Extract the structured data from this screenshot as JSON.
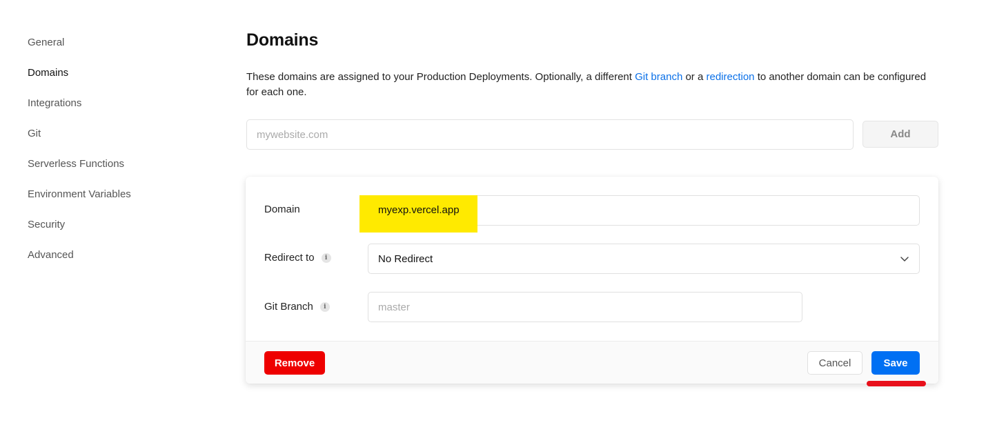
{
  "sidebar": {
    "items": [
      {
        "label": "General"
      },
      {
        "label": "Domains"
      },
      {
        "label": "Integrations"
      },
      {
        "label": "Git"
      },
      {
        "label": "Serverless Functions"
      },
      {
        "label": "Environment Variables"
      },
      {
        "label": "Security"
      },
      {
        "label": "Advanced"
      }
    ],
    "active_item": "Domains"
  },
  "page": {
    "title": "Domains",
    "description": {
      "part1": "These domains are assigned to your Production Deployments. Optionally, a different ",
      "link1": "Git branch",
      "part2": " or a ",
      "link2": "redirection",
      "part3": " to another domain can be configured for each one."
    },
    "add_domain": {
      "placeholder": "mywebsite.com",
      "value": "",
      "button_label": "Add"
    }
  },
  "domain_card": {
    "domain_label": "Domain",
    "domain_value": "myexp.vercel.app",
    "redirect_label": "Redirect to",
    "redirect_value": "No Redirect",
    "git_branch_label": "Git Branch",
    "git_branch_placeholder": "master",
    "git_branch_value": "",
    "info_icon_glyph": "i",
    "remove_label": "Remove",
    "cancel_label": "Cancel",
    "save_label": "Save"
  },
  "colors": {
    "link": "#0a70e8",
    "remove": "#ee0000",
    "save": "#0070f3",
    "highlight": "#ffea00",
    "annotation_underline": "#e8101b"
  },
  "icons": {
    "info": "info-icon",
    "dropdown": "chevron-down-icon"
  }
}
